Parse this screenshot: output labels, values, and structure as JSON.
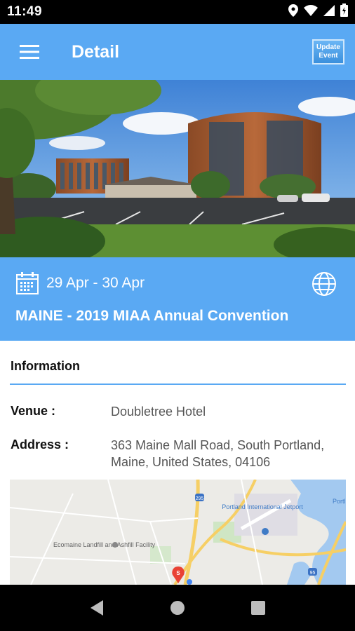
{
  "status": {
    "time": "11:49"
  },
  "app_bar": {
    "title": "Detail",
    "update_line1": "Update",
    "update_line2": "Event"
  },
  "event": {
    "date_range": "29 Apr - 30 Apr",
    "title": "MAINE - 2019 MIAA Annual Convention"
  },
  "information": {
    "section_title": "Information",
    "venue_label": "Venue :",
    "venue_value": "Doubletree Hotel",
    "address_label": "Address :",
    "address_value": "363 Maine Mall Road, South Portland, Maine, United States, 04106"
  },
  "map": {
    "label_airport": "Portland International Jetport",
    "label_landfill": "Ecomaine Landfill and Ashfill Facility",
    "label_edge": "Portl",
    "route_295": "295",
    "route_95": "95",
    "pin_letter": "S"
  },
  "colors": {
    "primary": "#5aa9f3"
  }
}
